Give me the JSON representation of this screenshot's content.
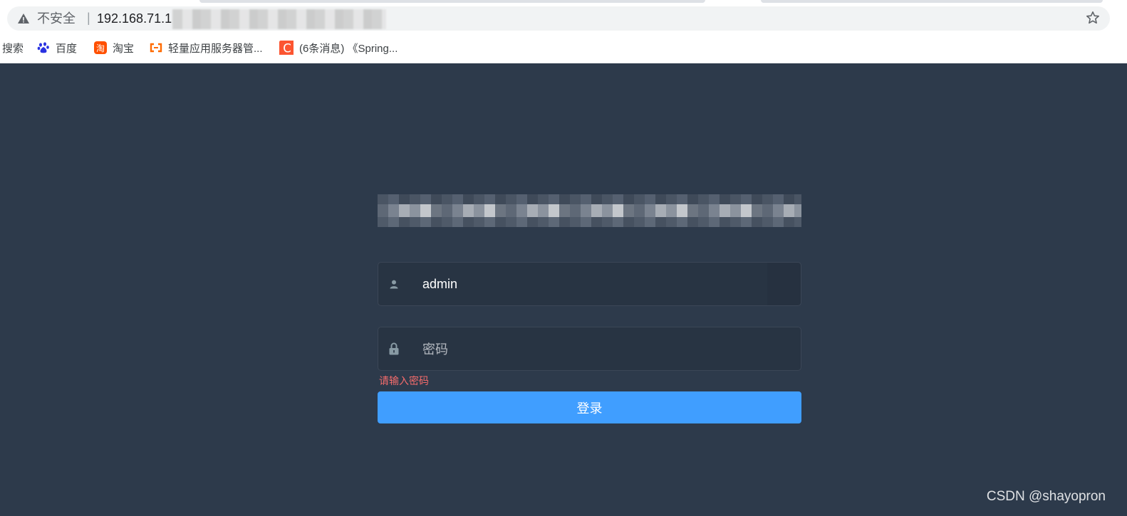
{
  "browser": {
    "security_label": "不安全",
    "separator": "|",
    "url": "192.168.71.1",
    "bookmarks": [
      {
        "label": "搜索",
        "icon": "search-bookmark"
      },
      {
        "label": "百度",
        "icon": "baidu-paw-icon"
      },
      {
        "label": "淘宝",
        "icon": "taobao-icon"
      },
      {
        "label": "轻量应用服务器管...",
        "icon": "aliyun-icon"
      },
      {
        "label": "(6条消息) 《Spring...",
        "icon": "csdn-icon"
      }
    ]
  },
  "login": {
    "username_value": "admin",
    "password_placeholder": "密码",
    "password_error": "请输入密码",
    "submit_label": "登录"
  },
  "watermark": "CSDN @shayopron",
  "colors": {
    "page_background": "#2d3a4b",
    "input_background": "#283443",
    "button": "#409eff",
    "error": "#f56c6c"
  }
}
